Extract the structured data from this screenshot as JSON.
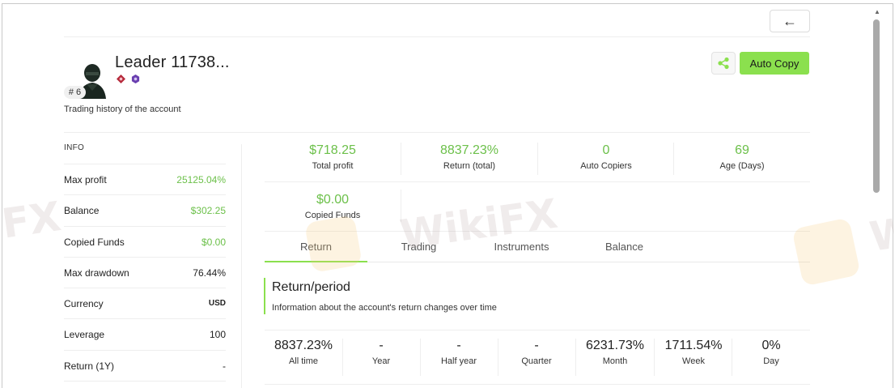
{
  "header": {
    "back_icon": "arrow-left-icon",
    "back_glyph": "←"
  },
  "profile": {
    "rank": "# 6",
    "name": "Leader 11738...",
    "subtitle": "Trading history of the account",
    "badge_colors": [
      "#b5283a",
      "#6a3fb0"
    ]
  },
  "actions": {
    "share_icon": "share-icon",
    "auto_copy_label": "Auto Copy",
    "accent_color": "#8be04e"
  },
  "info": {
    "title": "INFO",
    "rows": [
      {
        "label": "Max profit",
        "value": "25125.04%"
      },
      {
        "label": "Balance",
        "value": "$302.25"
      },
      {
        "label": "Copied Funds",
        "value": "$0.00"
      },
      {
        "label": "Max drawdown",
        "value": "76.44%"
      },
      {
        "label": "Currency",
        "value": "USD"
      },
      {
        "label": "Leverage",
        "value": "100"
      },
      {
        "label": "Return (1Y)",
        "value": "-"
      }
    ]
  },
  "stats": [
    {
      "value": "$718.25",
      "label": "Total profit"
    },
    {
      "value": "8837.23%",
      "label": "Return (total)"
    },
    {
      "value": "0",
      "label": "Auto Copiers"
    },
    {
      "value": "69",
      "label": "Age (Days)"
    },
    {
      "value": "$0.00",
      "label": "Copied Funds"
    }
  ],
  "tabs": [
    {
      "label": "Return",
      "active": true
    },
    {
      "label": "Trading",
      "active": false
    },
    {
      "label": "Instruments",
      "active": false
    },
    {
      "label": "Balance",
      "active": false
    }
  ],
  "section": {
    "title": "Return/period",
    "description": "Information about the account's return changes over time"
  },
  "periods": [
    {
      "value": "8837.23%",
      "label": "All time"
    },
    {
      "value": "-",
      "label": "Year"
    },
    {
      "value": "-",
      "label": "Half year"
    },
    {
      "value": "-",
      "label": "Quarter"
    },
    {
      "value": "6231.73%",
      "label": "Month"
    },
    {
      "value": "1711.54%",
      "label": "Week"
    },
    {
      "value": "0%",
      "label": "Day"
    }
  ],
  "watermark": {
    "text": "WikiFX"
  }
}
